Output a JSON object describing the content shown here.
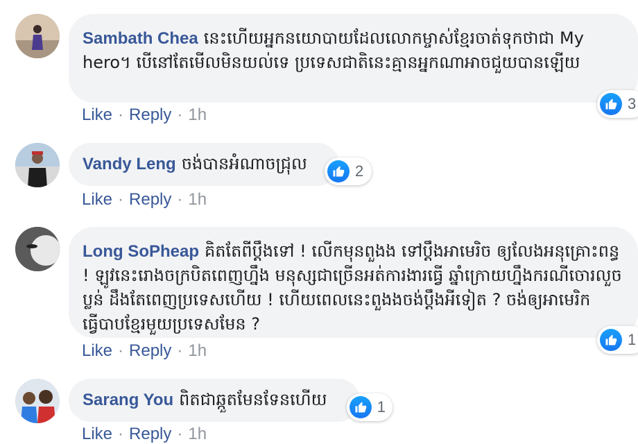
{
  "colors": {
    "name_blue": "#385898",
    "bubble_bg": "#f2f3f5",
    "meta_grey": "#90949c",
    "like_blue": "#1877f2"
  },
  "comments": [
    {
      "author": "Sambath Chea",
      "text": "នេះហើយអ្នកនយោបាយដែលលោកម្ចាស់ខ្មែរចាត់ទុកថាជា My hero។ បើនៅតែមើលមិនយល់ទេ ប្រទេសជាតិនេះគ្មានអ្នកណាអាចជួយបានឡើយ",
      "like": "Like",
      "reply": "Reply",
      "time": "1h",
      "reaction_count": "3",
      "reaction_icon": "thumbs-up-icon"
    },
    {
      "author": "Vandy Leng",
      "text": "ចង់បានអំណាចជ្រុល",
      "like": "Like",
      "reply": "Reply",
      "time": "1h",
      "reaction_count": "2",
      "reaction_icon": "thumbs-up-icon"
    },
    {
      "author": "Long SoPheap",
      "text": "គិតតែពីប្ដឹងទៅ ! លើកមុនពួងង ទៅប្ដឹងអាមេរិច ឲ្យលែងអនុគ្រោះពន្ធ ! ឡូវនេះរោងចក្របិតពេញហ្នឹង មនុស្សជាច្រើនអត់ការងារធ្វើ ឆ្នាំក្រោយហ្នឹងករណីចោរលួច ប្លន់ ដឹងតែពេញប្រទេសហើយ ! ហើយពេលនេះពួងងចង់ប្ដឹងអីទៀត ? ចង់ឲ្យអាមេរិកធ្វើបាបខ្មែរមួយប្រទេសមែន ?",
      "like": "Like",
      "reply": "Reply",
      "time": "1h",
      "reaction_count": "1",
      "reaction_icon": "thumbs-up-icon"
    },
    {
      "author": "Sarang You",
      "text": "ពិតជាឆ្កួតមែនទែនហើយ",
      "like": "Like",
      "reply": "Reply",
      "time": "1h",
      "reaction_count": "1",
      "reaction_icon": "thumbs-up-icon"
    }
  ]
}
